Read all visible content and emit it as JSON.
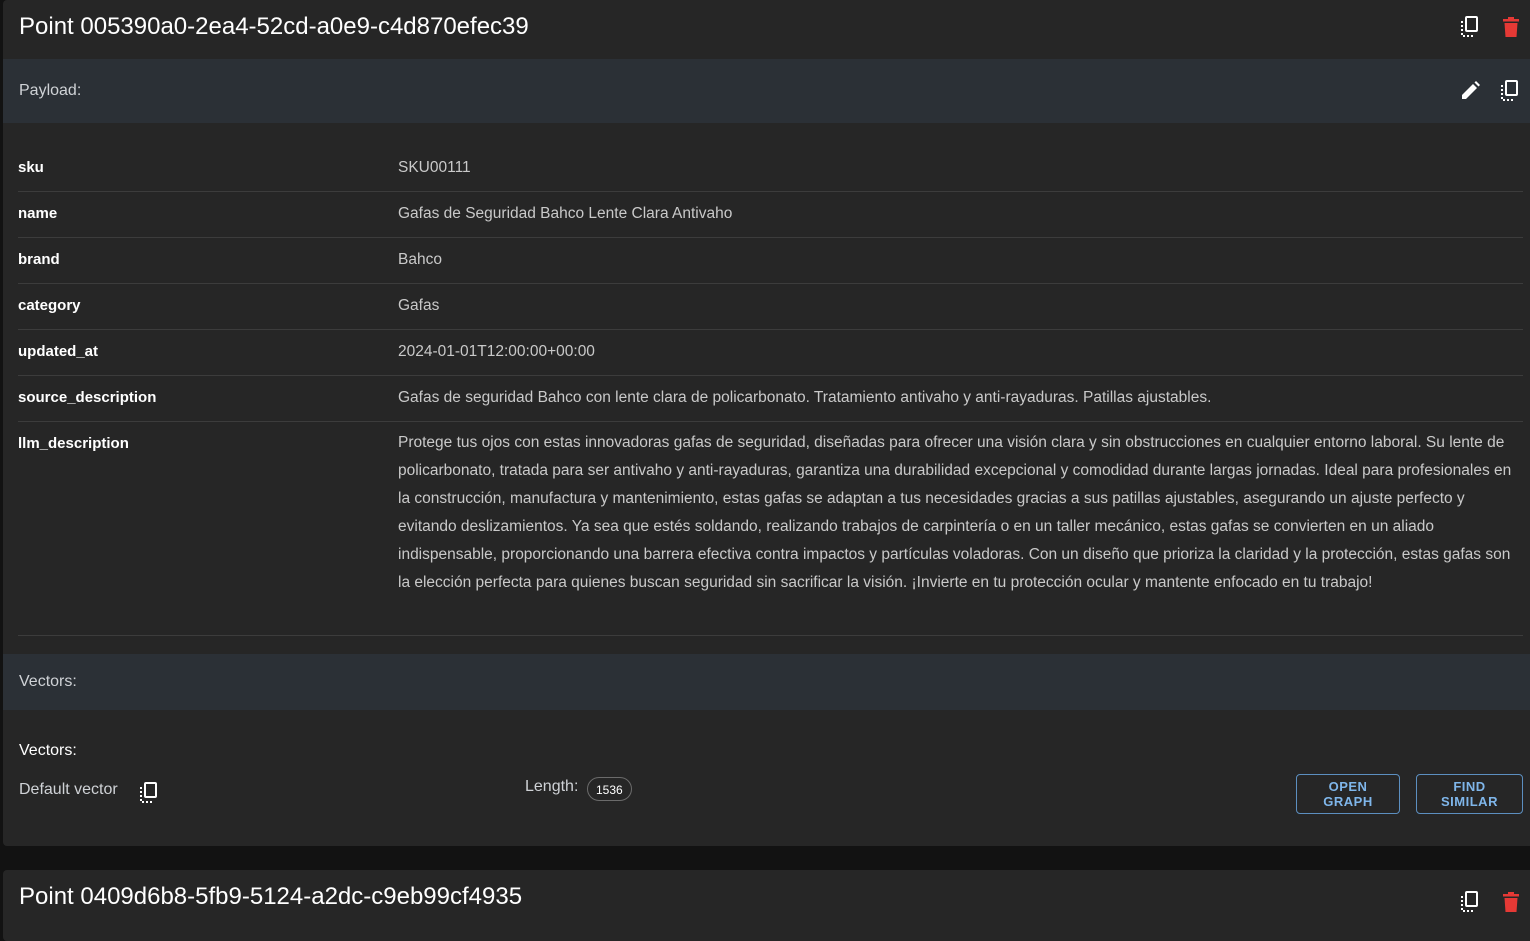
{
  "points": [
    {
      "title": "Point 005390a0-2ea4-52cd-a0e9-c4d870efec39",
      "payload_label": "Payload:",
      "payload": [
        {
          "key": "sku",
          "value": "SKU00111"
        },
        {
          "key": "name",
          "value": "Gafas de Seguridad Bahco Lente Clara Antivaho"
        },
        {
          "key": "brand",
          "value": "Bahco"
        },
        {
          "key": "category",
          "value": "Gafas"
        },
        {
          "key": "updated_at",
          "value": "2024-01-01T12:00:00+00:00"
        },
        {
          "key": "source_description",
          "value": "Gafas de seguridad Bahco con lente clara de policarbonato. Tratamiento antivaho y anti-rayaduras. Patillas ajustables."
        },
        {
          "key": "llm_description",
          "value": "Protege tus ojos con estas innovadoras gafas de seguridad, diseñadas para ofrecer una visión clara y sin obstrucciones en cualquier entorno laboral. Su lente de policarbonato, tratada para ser antivaho y anti-rayaduras, garantiza una durabilidad excepcional y comodidad durante largas jornadas. Ideal para profesionales en la construcción, manufactura y mantenimiento, estas gafas se adaptan a tus necesidades gracias a sus patillas ajustables, asegurando un ajuste perfecto y evitando deslizamientos. Ya sea que estés soldando, realizando trabajos de carpintería o en un taller mecánico, estas gafas se convierten en un aliado indispensable, proporcionando una barrera efectiva contra impactos y partículas voladoras. Con un diseño que prioriza la claridad y la protección, estas gafas son la elección perfecta para quienes buscan seguridad sin sacrificar la visión. ¡Invierte en tu protección ocular y mantente enfocado en tu trabajo!"
        }
      ],
      "vectors_section_label": "Vectors:",
      "vectors_title": "Vectors:",
      "vector": {
        "name": "Default vector",
        "length_label": "Length:",
        "length": "1536"
      },
      "buttons": {
        "open_graph": "OPEN GRAPH",
        "find_similar": "FIND SIMILAR"
      }
    },
    {
      "title": "Point 0409d6b8-5fb9-5124-a2dc-c9eb99cf4935"
    }
  ],
  "icons": {
    "copy": "copy-icon",
    "delete": "delete-icon",
    "edit": "edit-icon"
  },
  "colors": {
    "page_bg": "#121212",
    "card_bg": "#262626",
    "section_bg": "#2b3036",
    "delete_red": "#e53935",
    "button_blue": "#7fb6ea"
  }
}
